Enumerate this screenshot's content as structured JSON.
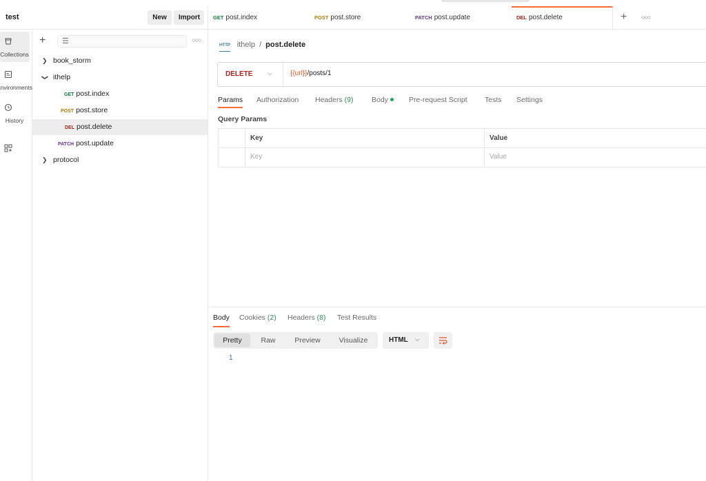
{
  "workspace": {
    "name": "test",
    "new_label": "New",
    "import_label": "Import"
  },
  "tabs": [
    {
      "method": "GET",
      "method_color": "#0f7a3c",
      "name": "post.index",
      "active": false
    },
    {
      "method": "POST",
      "method_color": "#ad7a03",
      "name": "post.store",
      "active": false
    },
    {
      "method": "PATCH",
      "method_color": "#623497",
      "name": "post.update",
      "active": false
    },
    {
      "method": "DEL",
      "method_color": "#a8221c",
      "name": "post.delete",
      "active": true
    }
  ],
  "rail": {
    "items": [
      {
        "icon": "collections-icon",
        "label": "Collections",
        "active": true
      },
      {
        "icon": "environments-icon",
        "label": "Environments",
        "active": false
      },
      {
        "icon": "history-icon",
        "label": "History",
        "active": false
      },
      {
        "icon": "apps-icon",
        "label": "",
        "active": false
      }
    ]
  },
  "sidebar": {
    "tree": [
      {
        "type": "folder",
        "name": "book_storm",
        "expanded": false
      },
      {
        "type": "folder",
        "name": "ithelp",
        "expanded": true
      },
      {
        "type": "request",
        "method": "GET",
        "method_color": "#0f7a3c",
        "name": "post.index",
        "selected": false
      },
      {
        "type": "request",
        "method": "POST",
        "method_color": "#ad7a03",
        "name": "post.store",
        "selected": false
      },
      {
        "type": "request",
        "method": "DEL",
        "method_color": "#a8221c",
        "name": "post.delete",
        "selected": true
      },
      {
        "type": "request",
        "method": "PATCH",
        "method_color": "#623497",
        "name": "post.update",
        "selected": false
      },
      {
        "type": "folder",
        "name": "protocol",
        "expanded": false
      }
    ]
  },
  "breadcrumb": {
    "http_badge": "HTTP",
    "collection": "ithelp",
    "separator": "/",
    "request": "post.delete"
  },
  "request": {
    "method": "DELETE",
    "url_var": "{{url}}",
    "url_path": "/posts/1"
  },
  "request_tabs": [
    {
      "label": "Params",
      "count": "",
      "active": true
    },
    {
      "label": "Authorization",
      "count": "",
      "active": false
    },
    {
      "label": "Headers",
      "count": "(9)",
      "active": false
    },
    {
      "label": "Body",
      "count": "",
      "active": false
    },
    {
      "label": "Pre-request Script",
      "count": "",
      "active": false
    },
    {
      "label": "Tests",
      "count": "",
      "active": false
    },
    {
      "label": "Settings",
      "count": "",
      "active": false
    }
  ],
  "query_params": {
    "title": "Query Params",
    "key_header": "Key",
    "value_header": "Value",
    "key_placeholder": "Key",
    "value_placeholder": "Value"
  },
  "response": {
    "tabs": [
      {
        "label": "Body",
        "count": "",
        "active": true
      },
      {
        "label": "Cookies",
        "count": "(2)",
        "active": false
      },
      {
        "label": "Headers",
        "count": "(8)",
        "active": false
      },
      {
        "label": "Test Results",
        "count": "",
        "active": false
      }
    ],
    "view_modes": [
      "Pretty",
      "Raw",
      "Preview",
      "Visualize"
    ],
    "active_view": "Pretty",
    "format": "HTML",
    "line_number": "1"
  },
  "colors": {
    "accent": "#ff6c37",
    "get": "#0f7a3c",
    "post": "#ad7a03",
    "patch": "#623497",
    "delete": "#a8221c",
    "url_var": "#e8531f"
  }
}
